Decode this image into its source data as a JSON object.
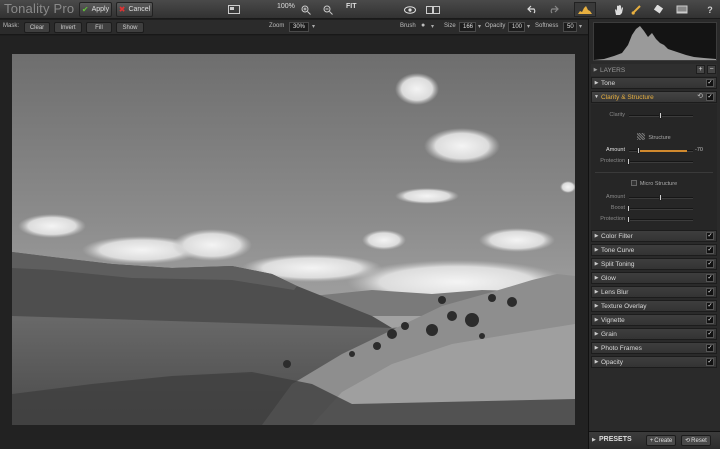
{
  "app": {
    "title": "Tonality Pro"
  },
  "toolbar": {
    "apply_label": "Apply",
    "cancel_label": "Cancel",
    "zoom_pct": "100%",
    "fit_label": "FIT"
  },
  "mask_bar": {
    "mask_label": "Mask:",
    "clear_label": "Clear",
    "invert_label": "Invert",
    "fill_label": "Fill",
    "show_label": "Show",
    "zoom_label": "Zoom",
    "zoom_value": "30%",
    "brush_label": "Brush",
    "size_label": "Size",
    "size_value": "166",
    "opacity_label": "Opacity",
    "opacity_value": "100",
    "softness_label": "Softness",
    "softness_value": "50"
  },
  "panel": {
    "layers_label": "LAYERS",
    "tone_label": "Tone",
    "clarity_structure_label": "Clarity & Structure",
    "clarity_label": "Clarity",
    "structure_label": "Structure",
    "amount_label": "Amount",
    "amount_value": "-70",
    "protection_label": "Protection",
    "micro_structure_label": "Micro Structure",
    "micro_amount_label": "Amount",
    "boost_label": "Boost",
    "micro_protection_label": "Protection",
    "sliders": {
      "clarity": 0.5,
      "amount": 0.15,
      "protection": 0.0,
      "micro_amount": 0.5,
      "boost": 0.0,
      "micro_protection": 0.0
    },
    "filters": [
      "Color Filter",
      "Tone Curve",
      "Split Toning",
      "Glow",
      "Lens Blur",
      "Texture Overlay",
      "Vignette",
      "Grain",
      "Photo Frames",
      "Opacity"
    ],
    "presets_label": "PRESETS",
    "create_label": "Create",
    "reset_label": "Reset"
  },
  "colors": {
    "apply": "#62c23a",
    "cancel": "#e03333",
    "accent": "#e8b040",
    "slider_fill": "#d0892e"
  }
}
